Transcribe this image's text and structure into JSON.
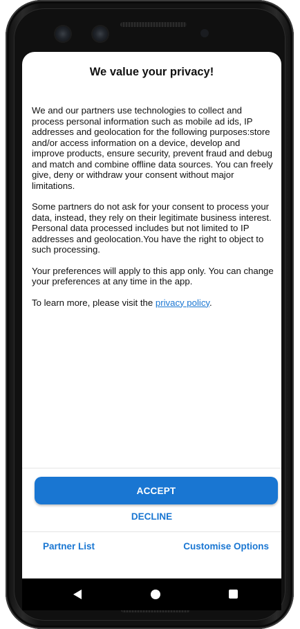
{
  "dialog": {
    "title": "We value your privacy!",
    "paragraphs": {
      "p1": "We and our partners use technologies to collect and process personal information such as mobile ad ids, IP addresses and geolocation for the following purposes:store and/or access information on a device, develop and improve products, ensure security, prevent fraud and debug and match and combine offline data sources. You can freely give, deny or withdraw your consent without major limitations.",
      "p2": "Some partners do not ask for your consent to process your data, instead, they rely on their legitimate business interest. Personal data processed includes but not limited to IP addresses and geolocation.You have the right to object to such processing.",
      "p3": "Your preferences will apply to this app only. You can change your preferences at any time in the app.",
      "p4_prefix": "To learn more, please visit the ",
      "p4_link": "privacy policy",
      "p4_suffix": "."
    }
  },
  "actions": {
    "accept_label": "ACCEPT",
    "decline_label": "DECLINE",
    "partner_list_label": "Partner List",
    "customise_label": "Customise Options"
  },
  "navbar": {
    "back_icon": "back-triangle-icon",
    "home_icon": "home-circle-icon",
    "recent_icon": "recent-apps-square-icon"
  },
  "colors": {
    "accent": "#1976d2",
    "text": "#111111",
    "background": "#ffffff"
  }
}
